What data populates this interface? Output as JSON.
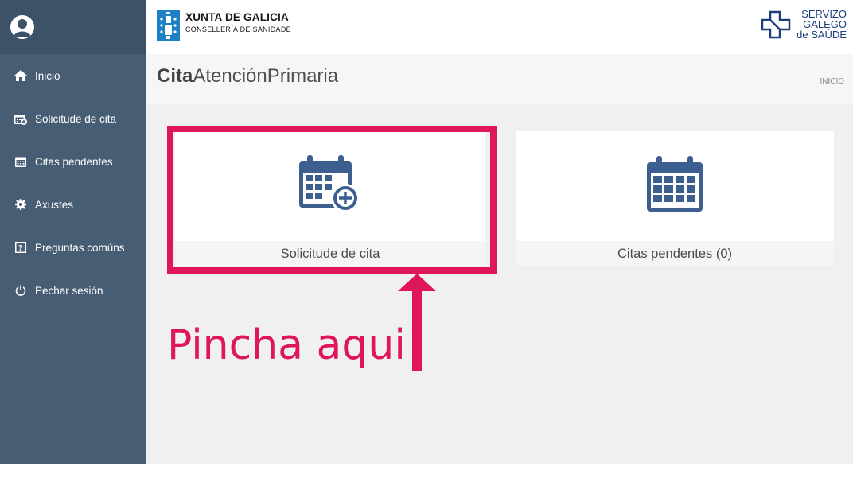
{
  "header": {
    "org_title": "XUNTA DE GALICIA",
    "org_subtitle": "CONSELLERÍA DE SANIDADE",
    "brand_lines": [
      "SERVIZO",
      "GALEGO",
      "de SAÚDE"
    ]
  },
  "sidebar": {
    "items": [
      {
        "label": "Inicio",
        "icon": "home-icon"
      },
      {
        "label": "Solicitude de cita",
        "icon": "calendar-plus-icon"
      },
      {
        "label": "Citas pendentes",
        "icon": "calendar-icon"
      },
      {
        "label": "Axustes",
        "icon": "gear-icon"
      },
      {
        "label": "Preguntas comúns",
        "icon": "question-icon"
      },
      {
        "label": "Pechar sesión",
        "icon": "power-icon"
      }
    ]
  },
  "page": {
    "title_bold": "Cita",
    "title_rest": "AtenciónPrimaria",
    "breadcrumb": "INICIO"
  },
  "cards": [
    {
      "label": "Solicitude de cita",
      "icon": "calendar-plus-icon"
    },
    {
      "label": "Citas pendentes (0)",
      "icon": "calendar-icon"
    }
  ],
  "annotation": {
    "text": "Pincha aqui",
    "color": "#e0165c"
  },
  "colors": {
    "sidebar": "#475d74",
    "icon_blue": "#3d5f8f",
    "accent": "#e0165c"
  }
}
